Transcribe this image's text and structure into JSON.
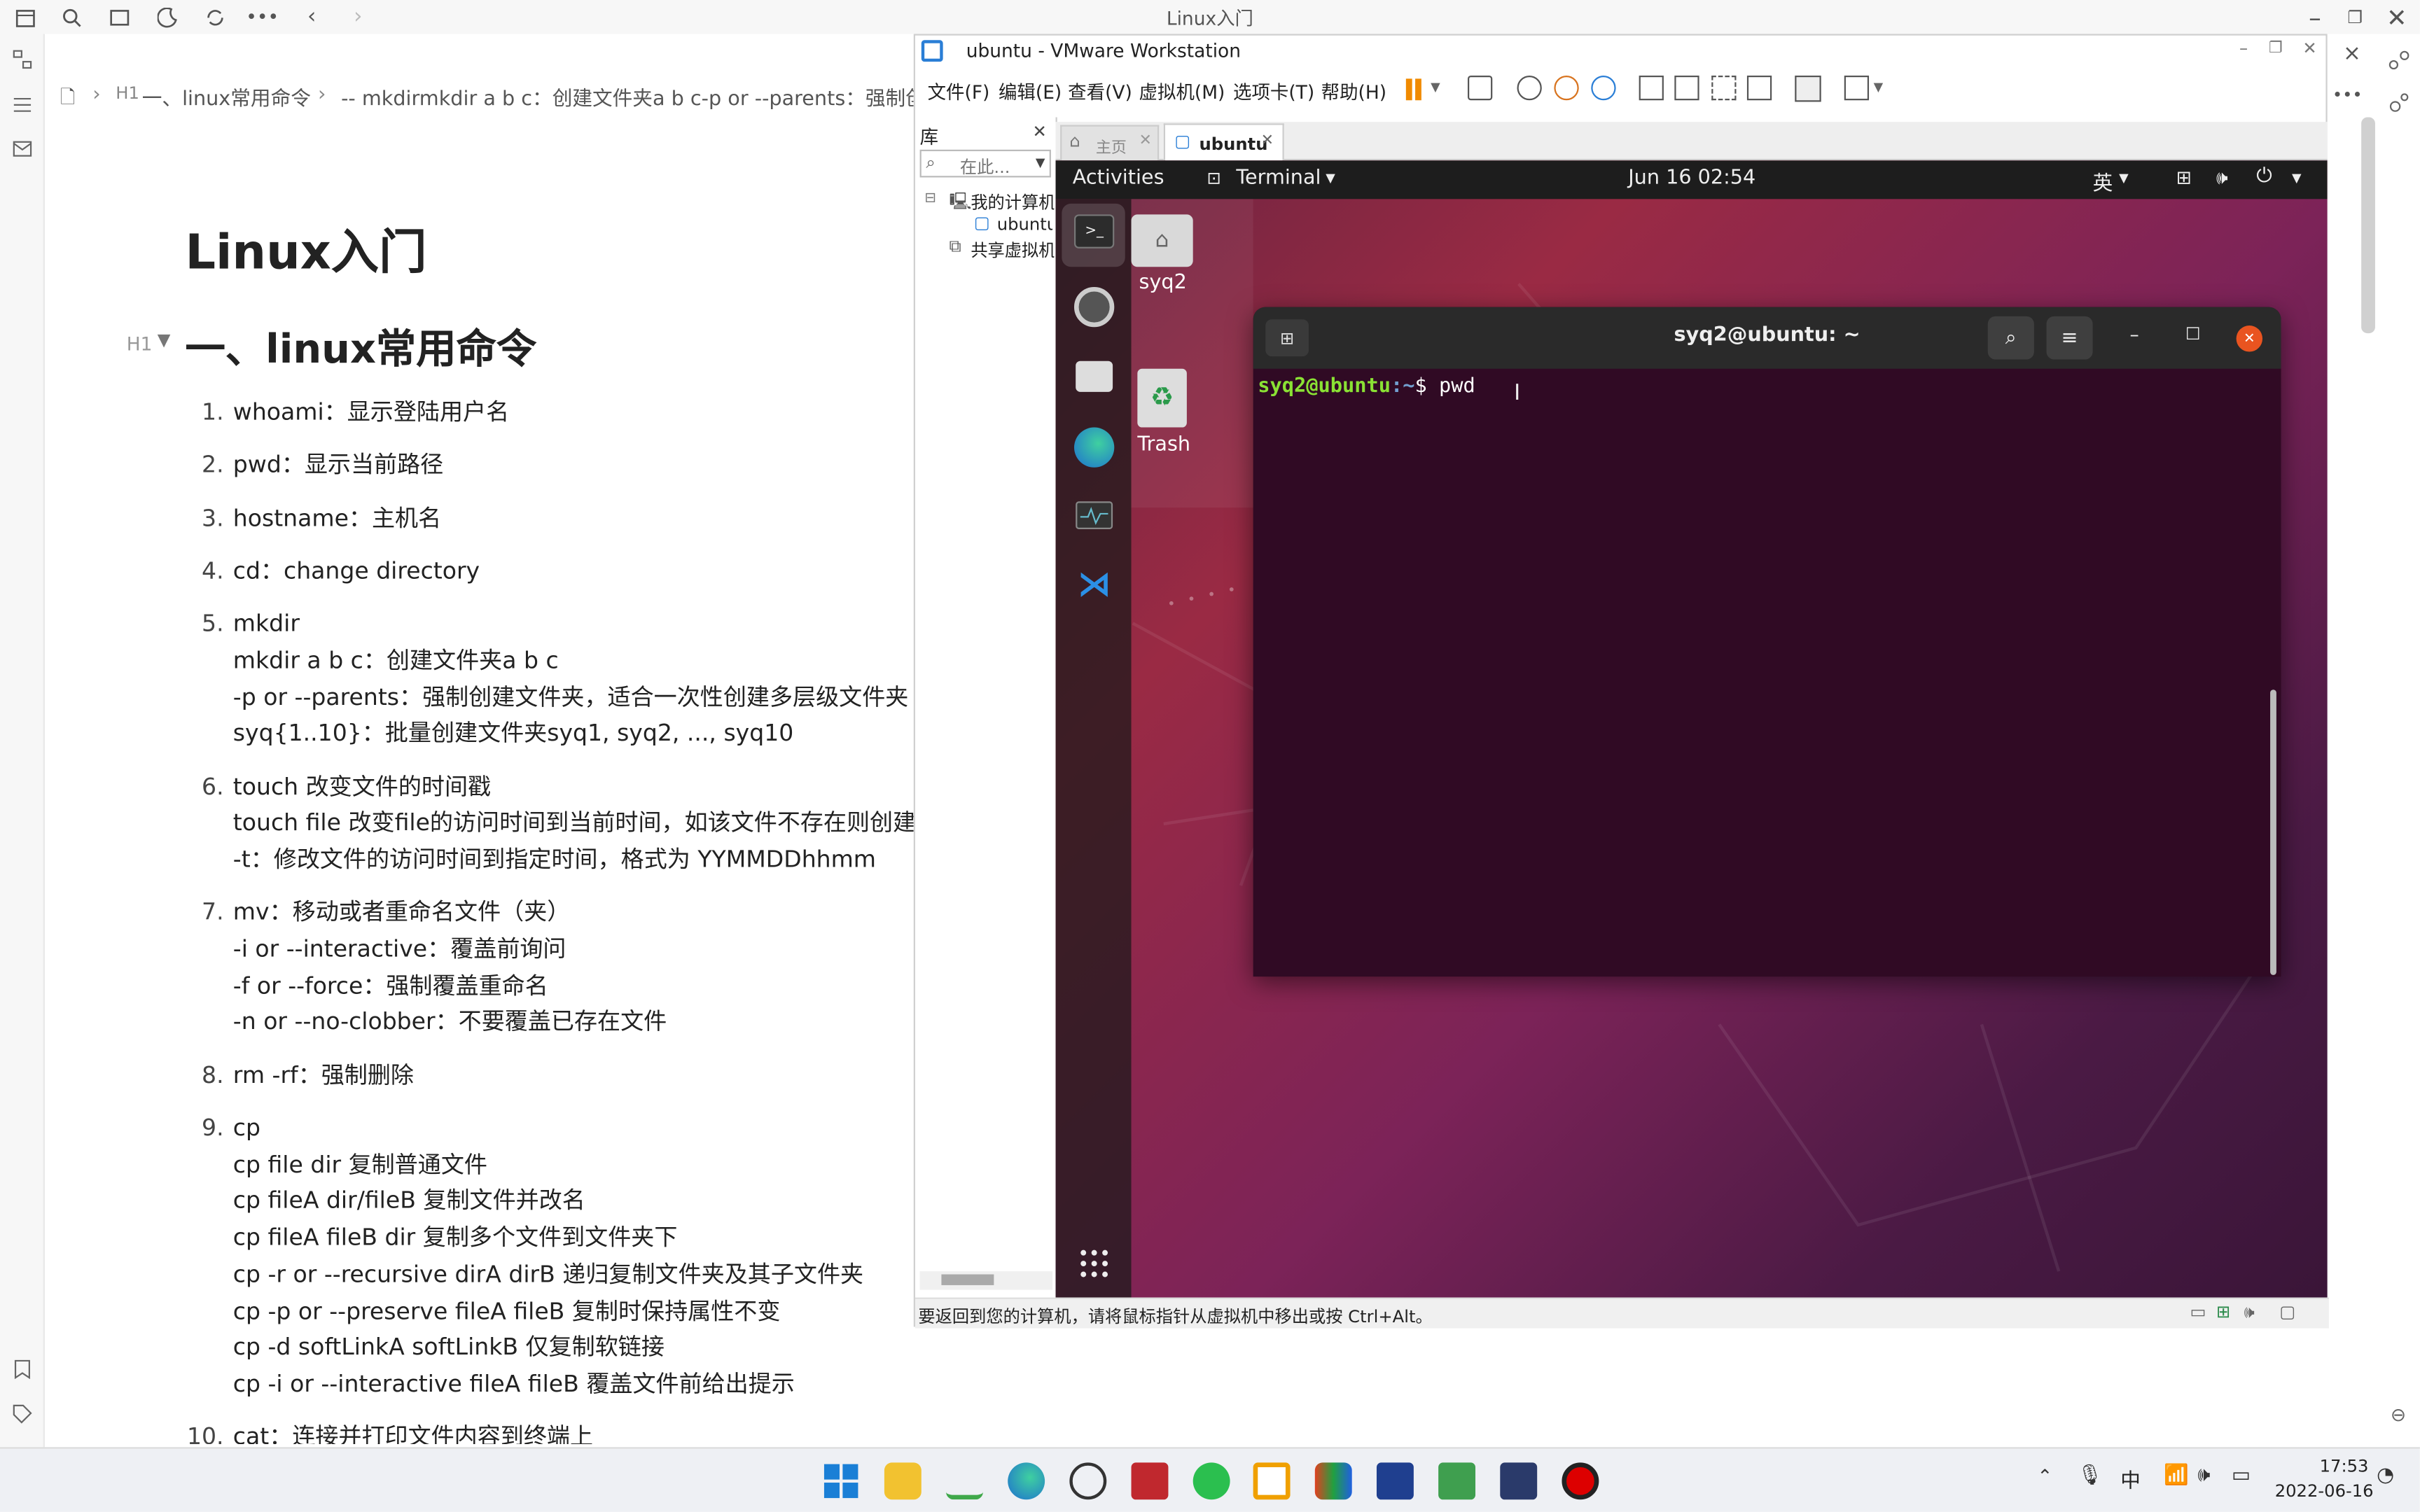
{
  "notes_app": {
    "window_title": "Linux入门",
    "breadcrumb": {
      "h1_prefix": "H1",
      "item1": "一、linux常用命令",
      "item2": "-- mkdirmkdir a b c：创建文件夹a b c-p or --parents：强制创建"
    },
    "doc_title": "Linux入门",
    "h2_label": "H1",
    "h2_text": "一、linux常用命令",
    "items": [
      {
        "num": "1.",
        "lines": [
          "whoami：显示登陆用户名"
        ]
      },
      {
        "num": "2.",
        "lines": [
          "pwd：显示当前路径"
        ]
      },
      {
        "num": "3.",
        "lines": [
          "hostname：主机名"
        ]
      },
      {
        "num": "4.",
        "lines": [
          "cd：change directory"
        ]
      },
      {
        "num": "5.",
        "lines": [
          "mkdir",
          "mkdir a b c：创建文件夹a b c",
          "-p or --parents：强制创建文件夹，适合一次性创建多层级文件夹",
          "syq{1..10}：批量创建文件夹syq1, syq2, ..., syq10"
        ]
      },
      {
        "num": "6.",
        "lines": [
          "touch 改变文件的时间戳",
          "touch file 改变file的访问时间到当前时间，如该文件不存在则创建之",
          "-t：修改文件的访问时间到指定时间，格式为 YYMMDDhhmm"
        ]
      },
      {
        "num": "7.",
        "lines": [
          "mv：移动或者重命名文件（夹）",
          "-i or --interactive：覆盖前询问",
          "-f or --force：强制覆盖重命名",
          "-n or --no-clobber：不要覆盖已存在文件"
        ]
      },
      {
        "num": "8.",
        "lines": [
          "rm -rf：强制删除"
        ]
      },
      {
        "num": "9.",
        "lines": [
          "cp",
          "cp file dir 复制普通文件",
          "cp fileA dir/fileB 复制文件并改名",
          "cp fileA fileB dir 复制多个文件到文件夹下",
          "cp -r or --recursive dirA dirB 递归复制文件夹及其子文件夹",
          "cp -p or --preserve fileA fileB 复制时保持属性不变",
          "cp -d softLinkA softLinkB 仅复制软链接",
          "cp -i or --interactive fileA fileB 覆盖文件前给出提示"
        ]
      },
      {
        "num": "10.",
        "lines": [
          "cat：连接并打印文件内容到终端上"
        ]
      }
    ]
  },
  "vmware": {
    "title": "ubuntu - VMware Workstation",
    "menu": [
      "文件(F)",
      "编辑(E)",
      "查看(V)",
      "虚拟机(M)",
      "选项卡(T)",
      "帮助(H)"
    ],
    "library_title": "库",
    "search_placeholder": "在此...",
    "tree": [
      "我的计算机",
      "ubuntu",
      "共享虚拟机"
    ],
    "tabs": [
      {
        "label": "主页"
      },
      {
        "label": "ubuntu"
      }
    ],
    "status_text": "要返回到您的计算机，请将鼠标指针从虚拟机中移出或按 Ctrl+Alt。"
  },
  "ubuntu": {
    "activities": "Activities",
    "app_menu": "Terminal",
    "clock": "Jun 16  02:54",
    "ime": "英",
    "desktop_icons": [
      "syq2",
      "Trash"
    ],
    "terminal": {
      "title": "syq2@ubuntu: ~",
      "prompt_user": "syq2@ubuntu",
      "prompt_path": ":~",
      "prompt_symbol": "$ ",
      "command": "pwd"
    }
  },
  "taskbar": {
    "ime": "中",
    "time": "17:53",
    "date": "2022-06-16"
  }
}
